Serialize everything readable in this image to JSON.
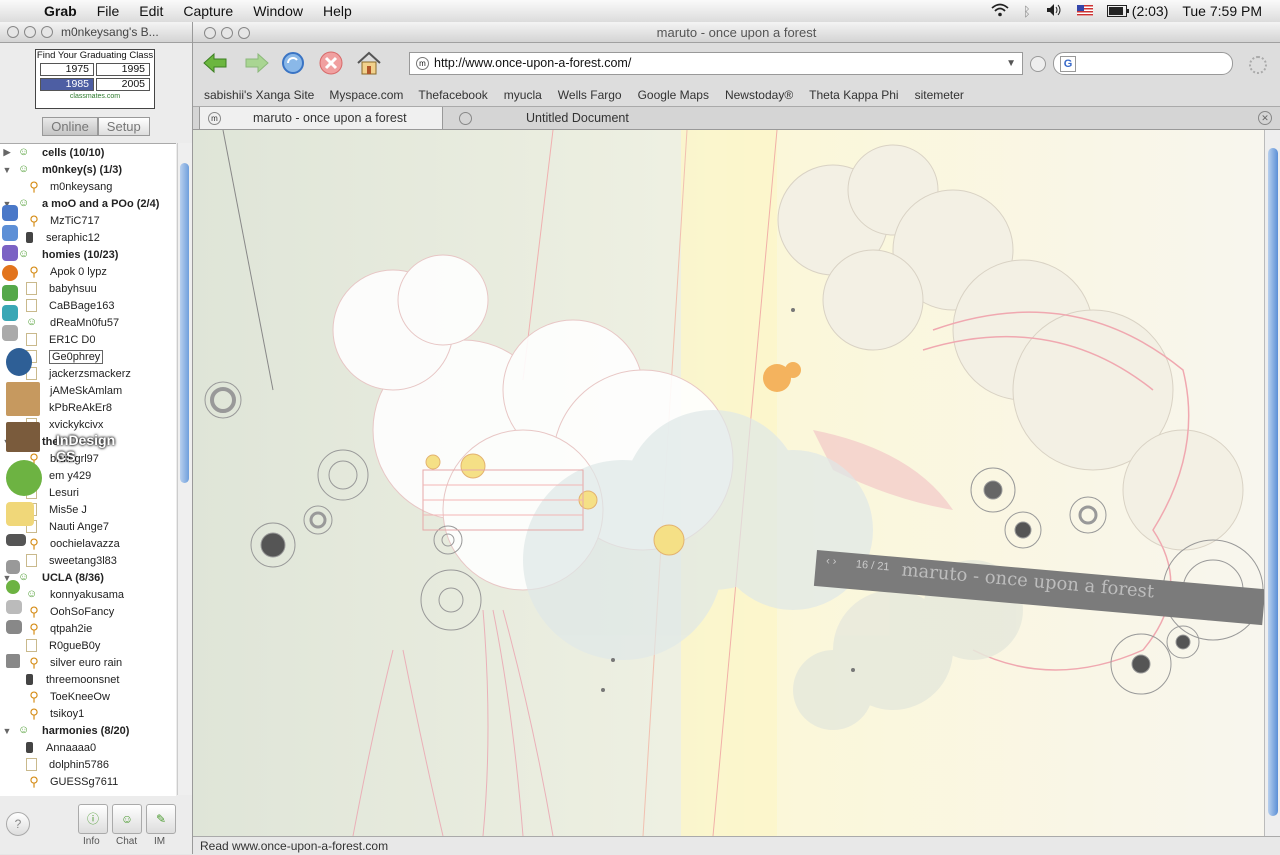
{
  "menubar": {
    "app_name": "Grab",
    "menus": [
      "File",
      "Edit",
      "Capture",
      "Window",
      "Help"
    ],
    "battery": "(2:03)",
    "clock": "Tue 7:59 PM"
  },
  "buddy_window": {
    "title": "m0nkeysang's B...",
    "ad": {
      "headline": "Find Your Graduating Class",
      "years": [
        "1975",
        "1995",
        "1985",
        "2005"
      ],
      "selected_year": "1985",
      "brand": "classmates.com"
    },
    "tabs": {
      "online": "Online",
      "setup": "Setup"
    },
    "rows": [
      {
        "type": "group",
        "label": "cells (10/10)",
        "expanded": false
      },
      {
        "type": "group",
        "label": "m0nkey(s) (1/3)",
        "expanded": true
      },
      {
        "type": "buddy",
        "label": "m0nkeysang",
        "icon": "runner"
      },
      {
        "type": "group",
        "label": "a moO and a POo (2/4)",
        "expanded": true
      },
      {
        "type": "buddy",
        "label": "MzTiC717",
        "icon": "runner"
      },
      {
        "type": "buddy",
        "label": "seraphic12",
        "icon": "phone"
      },
      {
        "type": "group",
        "label": "homies (10/23)",
        "expanded": true
      },
      {
        "type": "buddy",
        "label": "Apok 0 lypz",
        "icon": "runner"
      },
      {
        "type": "buddy",
        "label": "babyhsuu",
        "icon": "note"
      },
      {
        "type": "buddy",
        "label": "CaBBage163",
        "icon": "note"
      },
      {
        "type": "buddy",
        "label": "dReaMn0fu57",
        "icon": "group"
      },
      {
        "type": "buddy",
        "label": "ER1C D0",
        "icon": "note"
      },
      {
        "type": "buddy",
        "label": "Ge0phrey",
        "icon": "note",
        "selected": true
      },
      {
        "type": "buddy",
        "label": "jackerzsmackerz",
        "icon": "note"
      },
      {
        "type": "buddy",
        "label": "jAMeSkAmlam",
        "icon": "runner"
      },
      {
        "type": "buddy",
        "label": "kPbReAkEr8",
        "icon": "note"
      },
      {
        "type": "buddy",
        "label": "xvickykcivx",
        "icon": "note"
      },
      {
        "type": "group",
        "label": "the",
        "expanded": true
      },
      {
        "type": "buddy",
        "label": "bruingrl97",
        "icon": "runner"
      },
      {
        "type": "buddy",
        "label": "em  y429",
        "icon": "note"
      },
      {
        "type": "buddy",
        "label": "Lesuri",
        "icon": "note"
      },
      {
        "type": "buddy",
        "label": "Mis5e J",
        "icon": "note"
      },
      {
        "type": "buddy",
        "label": "Nauti  Ange7",
        "icon": "note"
      },
      {
        "type": "buddy",
        "label": "oochielavazza",
        "icon": "runner"
      },
      {
        "type": "buddy",
        "label": "sweetang3l83",
        "icon": "note"
      },
      {
        "type": "group",
        "label": "UCLA (8/36)",
        "expanded": true
      },
      {
        "type": "buddy",
        "label": "konnyakusama",
        "icon": "group"
      },
      {
        "type": "buddy",
        "label": "OohSoFancy",
        "icon": "runner"
      },
      {
        "type": "buddy",
        "label": "qtpah2ie",
        "icon": "runner"
      },
      {
        "type": "buddy",
        "label": "R0gueB0y",
        "icon": "note"
      },
      {
        "type": "buddy",
        "label": "silver euro rain",
        "icon": "runner"
      },
      {
        "type": "buddy",
        "label": "threemoonsnet",
        "icon": "phone"
      },
      {
        "type": "buddy",
        "label": "ToeKneeOw",
        "icon": "runner"
      },
      {
        "type": "buddy",
        "label": "tsikoy1",
        "icon": "runner"
      },
      {
        "type": "group",
        "label": "harmonies (8/20)",
        "expanded": true
      },
      {
        "type": "buddy",
        "label": "Annaaaa0",
        "icon": "phone"
      },
      {
        "type": "buddy",
        "label": "dolphin5786",
        "icon": "note"
      },
      {
        "type": "buddy",
        "label": "GUESSg7611",
        "icon": "runner"
      }
    ],
    "footer": {
      "help": "?",
      "info": "Info",
      "chat": "Chat",
      "im": "IM"
    }
  },
  "dock": {
    "indesign_label": "InDesign CS"
  },
  "browser": {
    "title": "maruto - once upon a forest",
    "url": "http://www.once-upon-a-forest.com/",
    "bookmarks": [
      "sabishii's Xanga Site",
      "Myspace.com",
      "Thefacebook",
      "myucla",
      "Wells Fargo",
      "Google Maps",
      "Newstoday®",
      "Theta Kappa Phi",
      "sitemeter"
    ],
    "tabs": [
      "maruto - once upon a forest",
      "Untitled Document"
    ],
    "active_tab": 0,
    "gallery": {
      "counter": "16 / 21",
      "title": "maruto - once upon a forest"
    },
    "status": "Read www.once-upon-a-forest.com"
  },
  "colors": {
    "scroll_accent": "#5b8fd6",
    "apple_blue": "#2a6fd6",
    "buddy_green": "#4a9a2e"
  }
}
